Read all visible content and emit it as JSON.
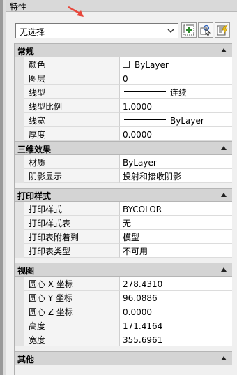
{
  "window": {
    "title": "特性"
  },
  "selector": {
    "value": "无选择"
  },
  "toolbar": [
    {
      "name": "toggle-pickadd-button",
      "icon": "pickadd-icon"
    },
    {
      "name": "select-objects-button",
      "icon": "select-objects-icon"
    },
    {
      "name": "quick-select-button",
      "icon": "quick-select-icon"
    }
  ],
  "sections": [
    {
      "title": "常规",
      "rows": [
        {
          "label": "颜色",
          "value": "ByLayer",
          "decor": "swatch"
        },
        {
          "label": "图层",
          "value": "0"
        },
        {
          "label": "线型",
          "value": "连续",
          "decor": "line"
        },
        {
          "label": "线型比例",
          "value": "1.0000"
        },
        {
          "label": "线宽",
          "value": "ByLayer",
          "decor": "line"
        },
        {
          "label": "厚度",
          "value": "0.0000"
        }
      ]
    },
    {
      "title": "三维效果",
      "rows": [
        {
          "label": "材质",
          "value": "ByLayer"
        },
        {
          "label": "阴影显示",
          "value": "投射和接收阴影"
        }
      ]
    },
    {
      "title": "打印样式",
      "rows": [
        {
          "label": "打印样式",
          "value": "BYCOLOR"
        },
        {
          "label": "打印样式表",
          "value": "无"
        },
        {
          "label": "打印表附着到",
          "value": "模型"
        },
        {
          "label": "打印表类型",
          "value": "不可用"
        }
      ]
    },
    {
      "title": "视图",
      "rows": [
        {
          "label": "圆心 X 坐标",
          "value": "278.4310"
        },
        {
          "label": "圆心 Y 坐标",
          "value": "96.0886"
        },
        {
          "label": "圆心 Z 坐标",
          "value": "0.0000"
        },
        {
          "label": "高度",
          "value": "171.4164"
        },
        {
          "label": "宽度",
          "value": "355.6961"
        }
      ]
    },
    {
      "title": "其他",
      "rows": []
    }
  ],
  "colors": {
    "accent_arrow": "#e8463a"
  }
}
